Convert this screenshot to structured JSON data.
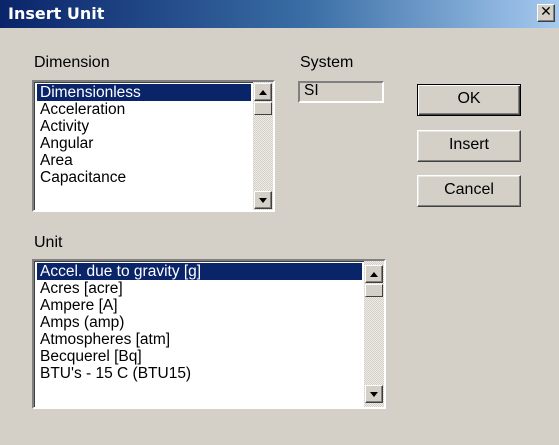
{
  "window": {
    "title": "Insert Unit",
    "close_glyph": "✕"
  },
  "dimension": {
    "label": "Dimension",
    "items": [
      "Dimensionless",
      "Acceleration",
      "Activity",
      "Angular",
      "Area",
      "Capacitance"
    ],
    "selected_index": 0
  },
  "system": {
    "label": "System",
    "value": "SI"
  },
  "unit": {
    "label": "Unit",
    "items": [
      "Accel. due to gravity [g]",
      "Acres [acre]",
      "Ampere [A]",
      "Amps (amp)",
      "Atmospheres [atm]",
      "Becquerel [Bq]",
      "BTU's - 15 C (BTU15)"
    ],
    "selected_index": 0
  },
  "buttons": {
    "ok": "OK",
    "insert": "Insert",
    "cancel": "Cancel"
  },
  "icons": {
    "scroll_up": "triangle-up-icon",
    "scroll_down": "triangle-down-icon",
    "close": "close-icon"
  },
  "colors": {
    "title_start": "#0a246a",
    "title_end": "#a6caf0",
    "selection": "#0a246a",
    "face": "#d4d0c8"
  }
}
